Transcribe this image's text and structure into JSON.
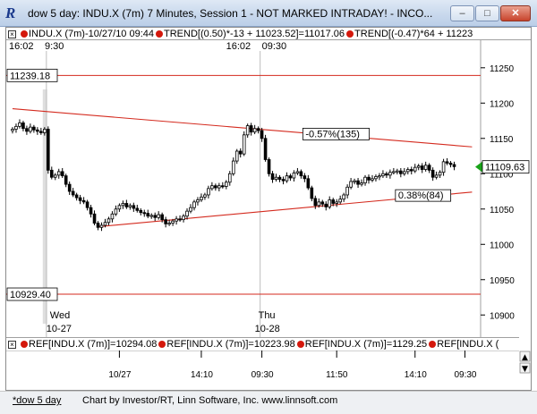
{
  "window": {
    "title": "dow 5 day: INDU.X (7m) 7 Minutes, Session 1 - NOT MARKED INTRADAY! - INCO...",
    "minimize_glyph": "–",
    "maximize_glyph": "□",
    "close_glyph": "✕",
    "app_icon_glyph": "R"
  },
  "top_legend": {
    "close_glyph": "×",
    "items": [
      "INDU.X (7m)-10/27/10 09:44",
      "TREND[(0.50)*-13 + 11023.52]=11017.06",
      "TREND[(-0.47)*64 + 11223"
    ]
  },
  "bottom_legend": {
    "close_glyph": "×",
    "items": [
      "REF[INDU.X (7m)]=10294.08",
      "REF[INDU.X (7m)]=10223.98",
      "REF[INDU.X (7m)]=1129.25",
      "REF[INDU.X ("
    ]
  },
  "status": {
    "tab_label": "*dow 5 day",
    "credit": "Chart by Investor/RT, Linn Software, Inc. www.linnsoft.com"
  },
  "colors": {
    "line": "#d42a1e",
    "candle": "#000000",
    "session_marker": "#c8c8c8",
    "price_marker": "#19a319"
  },
  "chart_data": {
    "type": "candlestick",
    "ylim": [
      10875,
      11270
    ],
    "y_ticks": [
      11250,
      11200,
      11150,
      11100,
      11050,
      11000,
      10950,
      10900
    ],
    "x_ticks": [
      "10/27",
      "14:10",
      "09:30",
      "11:50",
      "14:10",
      "09:30"
    ],
    "session_labels_top": [
      {
        "time": "16:02",
        "open": "9:30"
      },
      {
        "time": "16:02",
        "open": "09:30"
      }
    ],
    "day_labels": [
      {
        "day": "Wed",
        "date": "10-27"
      },
      {
        "day": "Thu",
        "date": "10-28"
      }
    ],
    "horizontal_levels": [
      {
        "label": "11239.18",
        "value": 11239.18
      },
      {
        "label": "10929.40",
        "value": 10929.4
      }
    ],
    "trend_lines": [
      {
        "name": "upper",
        "from": {
          "bar": 0,
          "value": 11192
        },
        "to": {
          "bar": 129,
          "value": 11138
        }
      },
      {
        "name": "lower",
        "from": {
          "bar": 24,
          "value": 11025
        },
        "to": {
          "bar": 129,
          "value": 11074
        }
      }
    ],
    "annotations": [
      {
        "text": "-0.57%(135)",
        "bar": 82,
        "value": 11153
      },
      {
        "text": "0.38%(84)",
        "bar": 108,
        "value": 11066
      }
    ],
    "last_price": "11109.63",
    "closes": [
      11163,
      11167,
      11172,
      11164,
      11160,
      11166,
      11162,
      11160,
      11158,
      11163,
      11105,
      11095,
      11098,
      11103,
      11097,
      11085,
      11075,
      11070,
      11066,
      11062,
      11060,
      11052,
      11043,
      11030,
      11024,
      11027,
      11031,
      11036,
      11043,
      11050,
      11055,
      11058,
      11053,
      11055,
      11051,
      11048,
      11045,
      11044,
      11040,
      11041,
      11038,
      11042,
      11035,
      11029,
      11030,
      11033,
      11036,
      11035,
      11040,
      11047,
      11052,
      11060,
      11063,
      11067,
      11070,
      11079,
      11083,
      11080,
      11083,
      11082,
      11088,
      11100,
      11118,
      11132,
      11128,
      11155,
      11168,
      11159,
      11164,
      11161,
      11150,
      11120,
      11100,
      11092,
      11095,
      11092,
      11090,
      11097,
      11094,
      11101,
      11103,
      11097,
      11093,
      11080,
      11065,
      11055,
      11060,
      11057,
      11053,
      11063,
      11058,
      11060,
      11064,
      11070,
      11081,
      11089,
      11090,
      11085,
      11087,
      11095,
      11091,
      11093,
      11096,
      11097,
      11100,
      11098,
      11102,
      11103,
      11104,
      11100,
      11103,
      11106,
      11104,
      11109,
      11111,
      11106,
      11112,
      11105,
      11095,
      11098,
      11102,
      11117,
      11115,
      11113,
      11110
    ]
  }
}
